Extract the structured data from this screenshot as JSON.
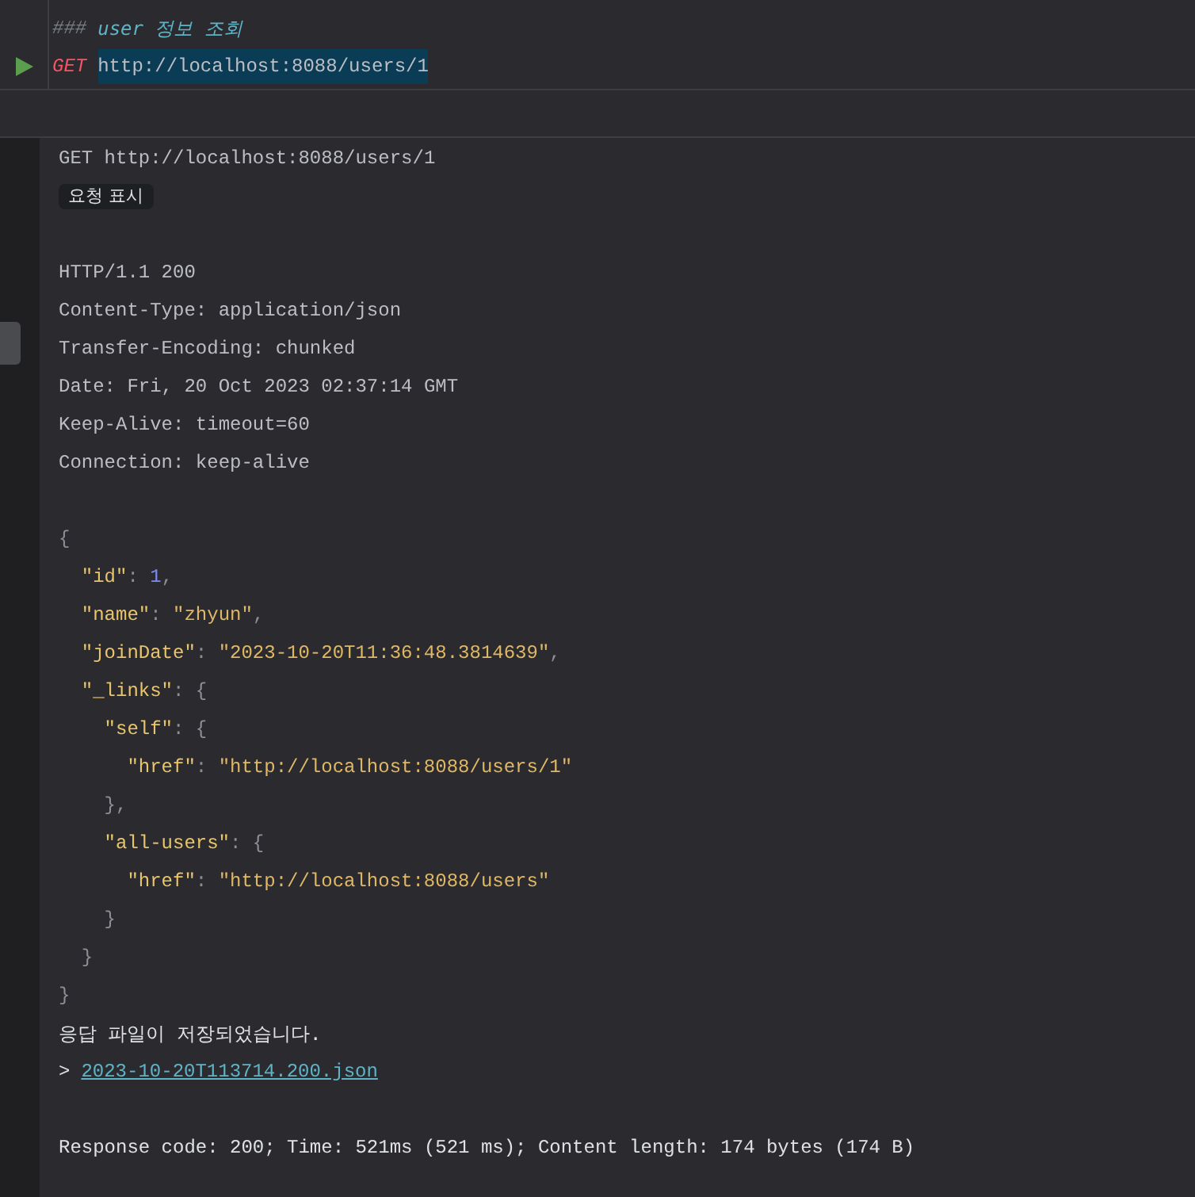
{
  "editor": {
    "lines": [
      {
        "kind": "comment",
        "marker": "###",
        "text": "user 정보 조회"
      },
      {
        "kind": "request",
        "method": "GET",
        "url": "http://localhost:8088/users/1",
        "url_selected": true
      }
    ]
  },
  "output": {
    "request_line": "GET http://localhost:8088/users/1",
    "show_request_button": "요청 표시",
    "headers": [
      "HTTP/1.1 200",
      "Content-Type: application/json",
      "Transfer-Encoding: chunked",
      "Date: Fri, 20 Oct 2023 02:37:14 GMT",
      "Keep-Alive: timeout=60",
      "Connection: keep-alive"
    ],
    "body": [
      {
        "tokens": [
          {
            "kind": "punct",
            "text": "{"
          }
        ],
        "children": [
          {
            "tokens": [
              {
                "kind": "key",
                "text": "\"id\""
              },
              {
                "kind": "punct",
                "text": ": "
              },
              {
                "kind": "number",
                "text": "1"
              },
              {
                "kind": "punct",
                "text": ","
              }
            ]
          },
          {
            "tokens": [
              {
                "kind": "key",
                "text": "\"name\""
              },
              {
                "kind": "punct",
                "text": ": "
              },
              {
                "kind": "string",
                "text": "\"zhyun\""
              },
              {
                "kind": "punct",
                "text": ","
              }
            ]
          },
          {
            "tokens": [
              {
                "kind": "key",
                "text": "\"joinDate\""
              },
              {
                "kind": "punct",
                "text": ": "
              },
              {
                "kind": "string",
                "text": "\"2023-10-20T11:36:48.3814639\""
              },
              {
                "kind": "punct",
                "text": ","
              }
            ]
          },
          {
            "tokens": [
              {
                "kind": "key",
                "text": "\"_links\""
              },
              {
                "kind": "punct",
                "text": ": {"
              }
            ],
            "children": [
              {
                "tokens": [
                  {
                    "kind": "key",
                    "text": "\"self\""
                  },
                  {
                    "kind": "punct",
                    "text": ": {"
                  }
                ],
                "children": [
                  {
                    "tokens": [
                      {
                        "kind": "key",
                        "text": "\"href\""
                      },
                      {
                        "kind": "punct",
                        "text": ": "
                      },
                      {
                        "kind": "string",
                        "text": "\"http://localhost:8088/users/1\""
                      }
                    ]
                  }
                ]
              },
              {
                "tokens": [
                  {
                    "kind": "punct",
                    "text": "},"
                  }
                ]
              },
              {
                "tokens": [
                  {
                    "kind": "key",
                    "text": "\"all-users\""
                  },
                  {
                    "kind": "punct",
                    "text": ": {"
                  }
                ],
                "children": [
                  {
                    "tokens": [
                      {
                        "kind": "key",
                        "text": "\"href\""
                      },
                      {
                        "kind": "punct",
                        "text": ": "
                      },
                      {
                        "kind": "string",
                        "text": "\"http://localhost:8088/users\""
                      }
                    ]
                  }
                ]
              },
              {
                "tokens": [
                  {
                    "kind": "punct",
                    "text": "}"
                  }
                ]
              }
            ]
          },
          {
            "tokens": [
              {
                "kind": "punct",
                "text": "}"
              }
            ]
          }
        ]
      },
      {
        "tokens": [
          {
            "kind": "punct",
            "text": "}"
          }
        ]
      }
    ],
    "saved_message": "응답 파일이 저장되었습니다.",
    "file_prompt": ">",
    "file_link": "2023-10-20T113714.200.json",
    "summary": "Response code: 200; Time: 521ms (521 ms); Content length: 174 bytes (174 B)"
  }
}
